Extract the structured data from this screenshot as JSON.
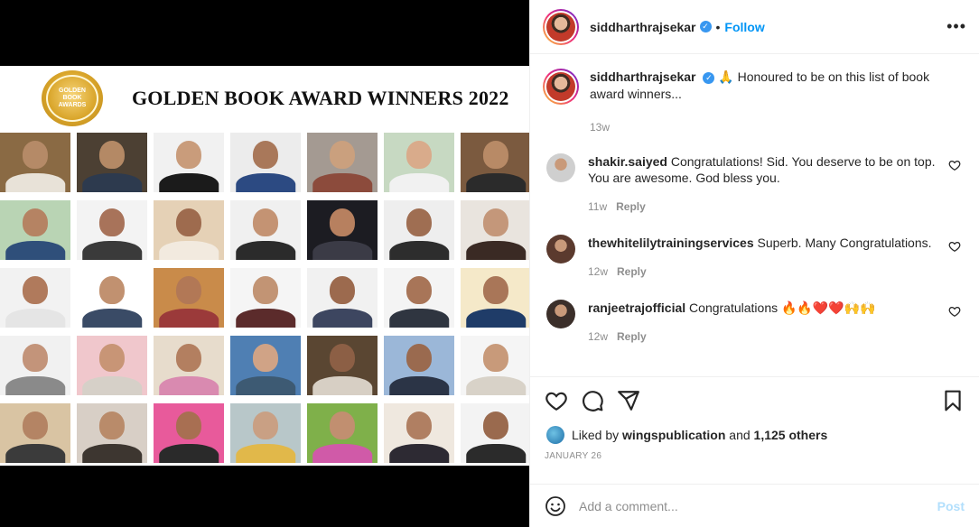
{
  "media": {
    "seal_text": "GOLDEN\nBOOK\nAWARDS",
    "title": "GOLDEN BOOK AWARD WINNERS 2022",
    "tiles": [
      {
        "bg": "#8a6a44",
        "skin": "#b58a67",
        "cloth": "#e8e2d8"
      },
      {
        "bg": "#4c4033",
        "skin": "#b48965",
        "cloth": "#2d3a4e"
      },
      {
        "bg": "#f1f1f1",
        "skin": "#c99c7b",
        "cloth": "#1b1b1b"
      },
      {
        "bg": "#ececec",
        "skin": "#a9785a",
        "cloth": "#2c4a82"
      },
      {
        "bg": "#a49a92",
        "skin": "#caa07e",
        "cloth": "#8c4b3c"
      },
      {
        "bg": "#c7d9c2",
        "skin": "#d9ab8b",
        "cloth": "#f1f1f1"
      },
      {
        "bg": "#7b5a3f",
        "skin": "#b88a66",
        "cloth": "#2b2b2b"
      },
      {
        "bg": "#b9d4b4",
        "skin": "#b58363",
        "cloth": "#2f4f7a"
      },
      {
        "bg": "#f3f3f3",
        "skin": "#a8735a",
        "cloth": "#3a3a3a"
      },
      {
        "bg": "#e5d1b6",
        "skin": "#9e6b4e",
        "cloth": "#f2eadf"
      },
      {
        "bg": "#f0f0f0",
        "skin": "#c49373",
        "cloth": "#2b2b2b"
      },
      {
        "bg": "#1c1c22",
        "skin": "#b7805f",
        "cloth": "#3b3b46"
      },
      {
        "bg": "#eeeeee",
        "skin": "#9f6e52",
        "cloth": "#2d2d2d"
      },
      {
        "bg": "#e9e4de",
        "skin": "#c4977a",
        "cloth": "#3a2a24"
      },
      {
        "bg": "#f2f2f2",
        "skin": "#b07a5c",
        "cloth": "#e5e5e5"
      },
      {
        "bg": "#ffffff",
        "skin": "#c19170",
        "cloth": "#3a4b66"
      },
      {
        "bg": "#c98b4a",
        "skin": "#b27856",
        "cloth": "#9b3a3a"
      },
      {
        "bg": "#f5f5f5",
        "skin": "#c29474",
        "cloth": "#5b2b2b"
      },
      {
        "bg": "#f1f1f1",
        "skin": "#9c6a4e",
        "cloth": "#3d4660"
      },
      {
        "bg": "#f4f4f4",
        "skin": "#a87558",
        "cloth": "#2f3540"
      },
      {
        "bg": "#f5e9c9",
        "skin": "#a97658",
        "cloth": "#1f3c68"
      },
      {
        "bg": "#f1f1f1",
        "skin": "#c3947a",
        "cloth": "#8a8a8a"
      },
      {
        "bg": "#f0c7cc",
        "skin": "#c89576",
        "cloth": "#d6d0c8"
      },
      {
        "bg": "#e7dccc",
        "skin": "#b37f60",
        "cloth": "#d98ab0"
      },
      {
        "bg": "#4f7fb3",
        "skin": "#d0a386",
        "cloth": "#3d5a73"
      },
      {
        "bg": "#5a4632",
        "skin": "#8c5f45",
        "cloth": "#d7cfc4"
      },
      {
        "bg": "#9bb7d8",
        "skin": "#9a6a4f",
        "cloth": "#2b3446"
      },
      {
        "bg": "#f5f5f5",
        "skin": "#c89a7a",
        "cloth": "#d8d2c8"
      },
      {
        "bg": "#d9c4a3",
        "skin": "#b48464",
        "cloth": "#3b3b3b"
      },
      {
        "bg": "#d8cfc6",
        "skin": "#b98b6a",
        "cloth": "#3d3630"
      },
      {
        "bg": "#e85a9b",
        "skin": "#a86f52",
        "cloth": "#2a2a2a"
      },
      {
        "bg": "#b8c7c9",
        "skin": "#c9a084",
        "cloth": "#e1b84a"
      },
      {
        "bg": "#7fb04a",
        "skin": "#c18f70",
        "cloth": "#d05aa8"
      },
      {
        "bg": "#efe8df",
        "skin": "#b07f62",
        "cloth": "#2d2a33"
      },
      {
        "bg": "#f3f3f3",
        "skin": "#9a6a4e",
        "cloth": "#2b2b2b"
      }
    ]
  },
  "post": {
    "username": "siddharthrajsekar",
    "follow_label": "Follow",
    "more_label": "•••",
    "caption": "🙏 Honoured to be on this list of book award winners...",
    "caption_time": "13w",
    "comments": [
      {
        "user": "shakir.saiyed",
        "text": "Congratulations! Sid. You deserve to be on top. You are awesome. God bless you.",
        "time": "11w",
        "reply": "Reply",
        "avatar_color": "#cfcfcf"
      },
      {
        "user": "thewhitelilytrainingservices",
        "text": "Superb. Many Congratulations.",
        "time": "12w",
        "reply": "Reply",
        "avatar_color": "#5b3a2e"
      },
      {
        "user": "ranjeetrajofficial",
        "text": "Congratulations 🔥🔥❤️❤️🙌🙌",
        "time": "12w",
        "reply": "Reply",
        "avatar_color": "#3b2f2a"
      }
    ],
    "liked_by_prefix": "Liked by",
    "liked_by_user": "wingspublication",
    "and_label": "and",
    "others": "1,125 others",
    "date": "JANUARY 26",
    "add_comment_placeholder": "Add a comment...",
    "post_label": "Post"
  }
}
